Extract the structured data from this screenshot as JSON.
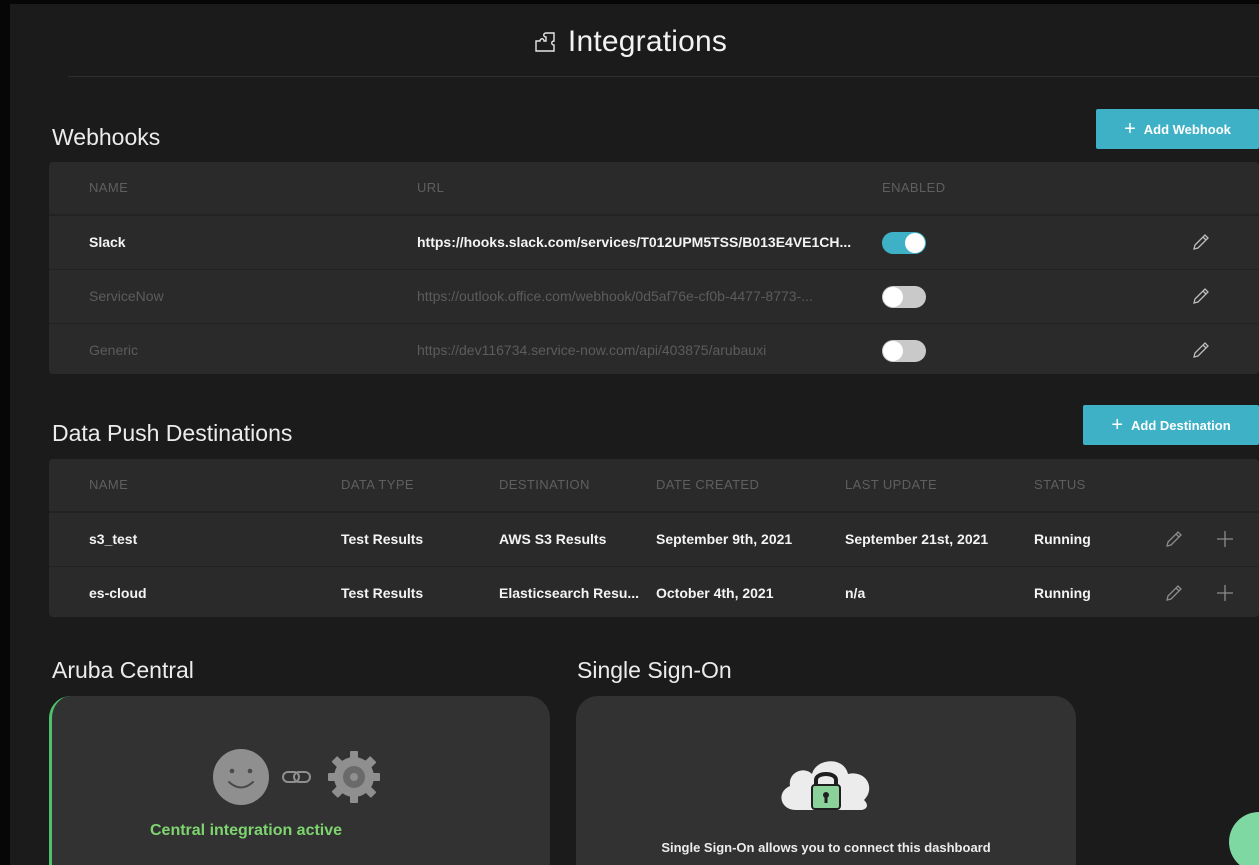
{
  "page": {
    "title": "Integrations"
  },
  "webhooks": {
    "title": "Webhooks",
    "add_label": "Add Webhook",
    "columns": {
      "name": "NAME",
      "url": "URL",
      "enabled": "ENABLED"
    },
    "rows": [
      {
        "name": "Slack",
        "url": "https://hooks.slack.com/services/T012UPM5TSS/B013E4VE1CH...",
        "enabled": true
      },
      {
        "name": "ServiceNow",
        "url": "https://outlook.office.com/webhook/0d5af76e-cf0b-4477-8773-...",
        "enabled": false
      },
      {
        "name": "Generic",
        "url": "https://dev116734.service-now.com/api/403875/arubauxi",
        "enabled": false
      }
    ]
  },
  "destinations": {
    "title": "Data Push Destinations",
    "add_label": "Add Destination",
    "columns": {
      "name": "NAME",
      "data_type": "DATA TYPE",
      "destination": "DESTINATION",
      "date_created": "DATE CREATED",
      "last_update": "LAST UPDATE",
      "status": "STATUS"
    },
    "rows": [
      {
        "name": "s3_test",
        "data_type": "Test Results",
        "destination": "AWS S3 Results",
        "date_created": "September 9th, 2021",
        "last_update": "September 21st, 2021",
        "status": "Running"
      },
      {
        "name": "es-cloud",
        "data_type": "Test Results",
        "destination": "Elasticsearch Resu...",
        "date_created": "October 4th, 2021",
        "last_update": "n/a",
        "status": "Running"
      }
    ]
  },
  "aruba_central": {
    "title": "Aruba Central",
    "status_text": "Central integration active"
  },
  "sso": {
    "title": "Single Sign-On",
    "description": "Single Sign-On allows you to connect this dashboard"
  },
  "colors": {
    "accent": "#3fb1c6",
    "success": "#7ed56f",
    "card_border": "#4fc16b"
  }
}
